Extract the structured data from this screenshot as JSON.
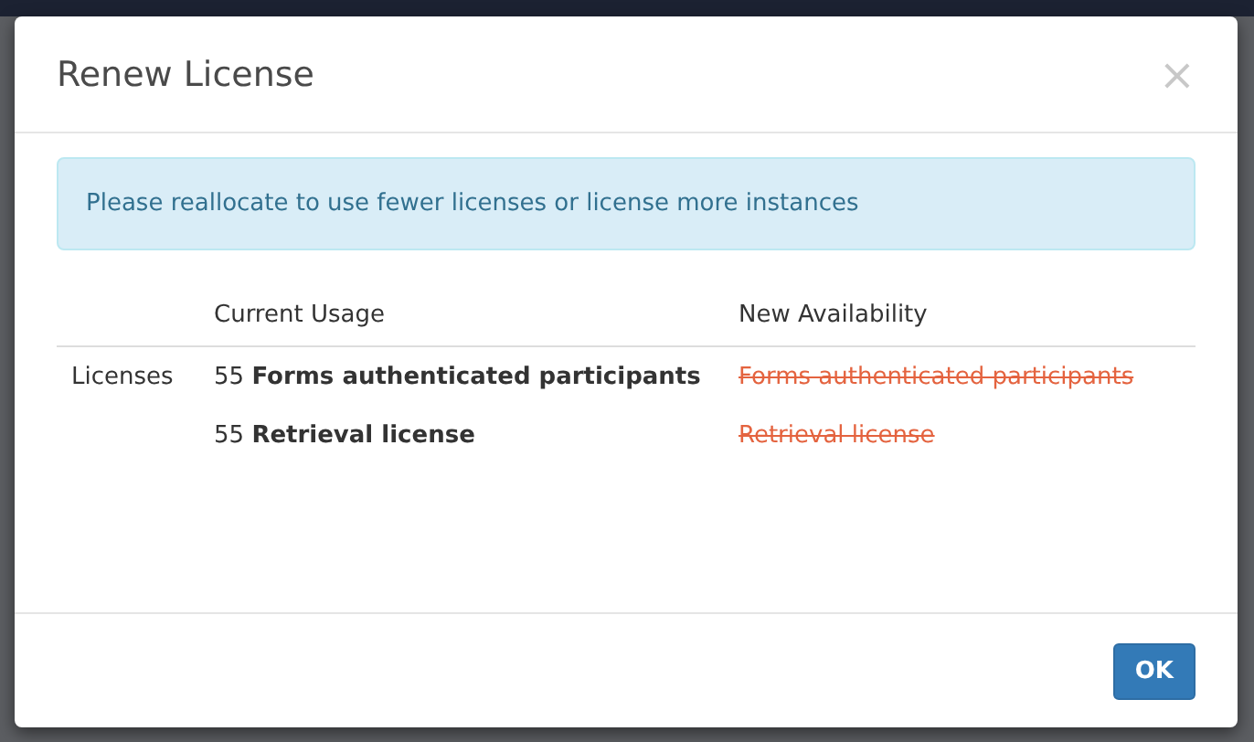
{
  "dialog": {
    "title": "Renew License",
    "close": "×",
    "alert": "Please reallocate to use fewer licenses or license more instances",
    "table": {
      "columns": [
        "Current Usage",
        "New Availability"
      ],
      "rows": [
        {
          "category": "Licenses",
          "count": "55",
          "name": "Forms authenticated participants",
          "availability": "Forms authenticated participants",
          "unavailable": true
        },
        {
          "count": "55",
          "name": "Retrieval license",
          "availability": "Retrieval license",
          "unavailable": true
        }
      ]
    },
    "buttons": [
      "OK"
    ]
  }
}
